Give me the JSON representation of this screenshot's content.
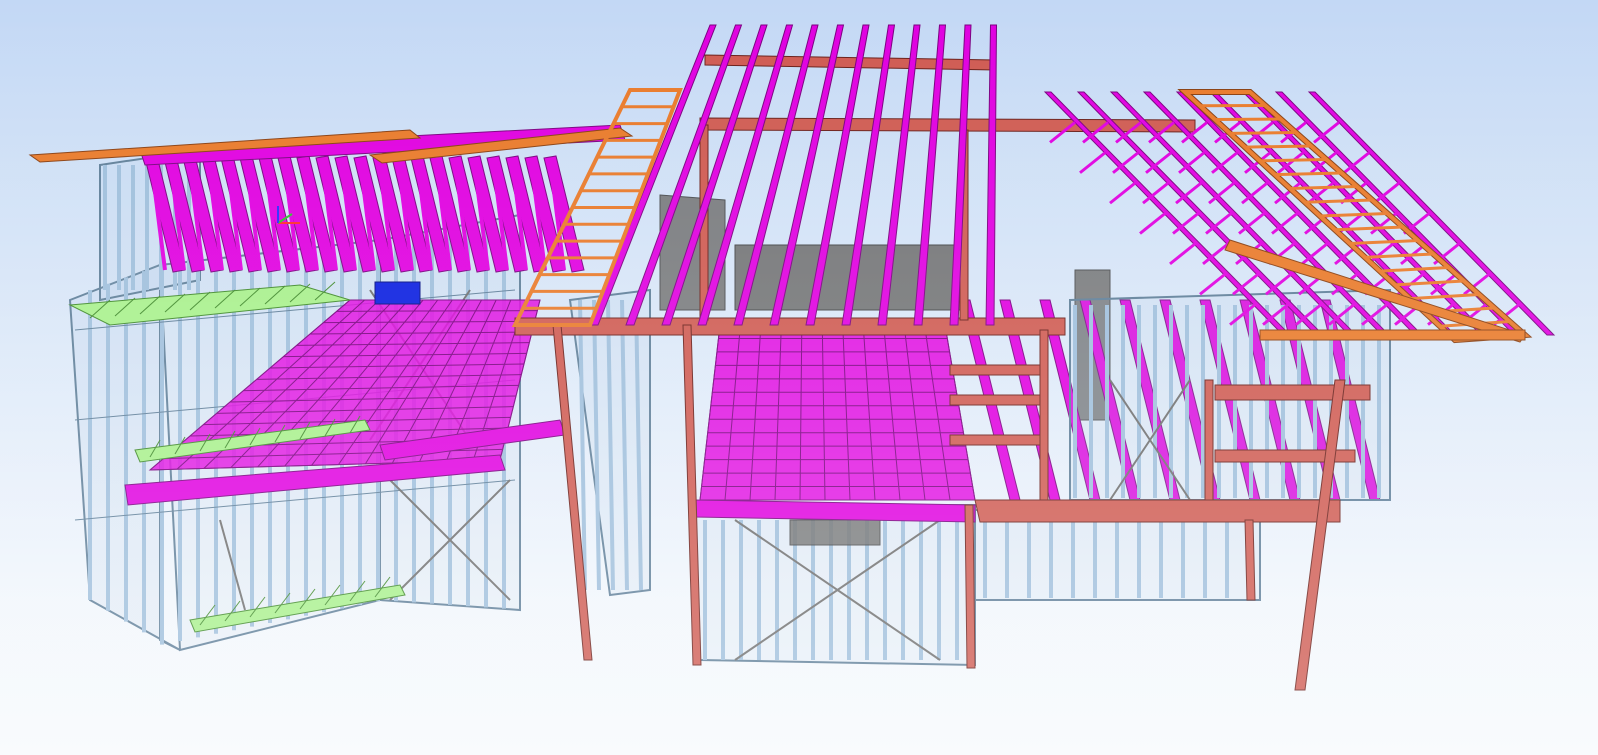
{
  "viewport": {
    "background_top": "#c3d8f5",
    "background_bottom": "#f7fafd"
  },
  "model": {
    "colors": {
      "wall_studs": "#9fbfdc",
      "wall_outline": "#5f7f99",
      "roof_trusses": "#e000e0",
      "floor_joists": "#e000e0",
      "eave_framing": "#e97a2a",
      "beams_columns": "#cf5b52",
      "deck_framing": "#a8f08c",
      "sheet_panel": "#6b6b6b",
      "selected_member": "#0a1ee0"
    }
  },
  "axis_gizmo": {
    "x_color": "#ff2a2a",
    "y_color": "#2ac42a",
    "z_color": "#2a2aff"
  }
}
